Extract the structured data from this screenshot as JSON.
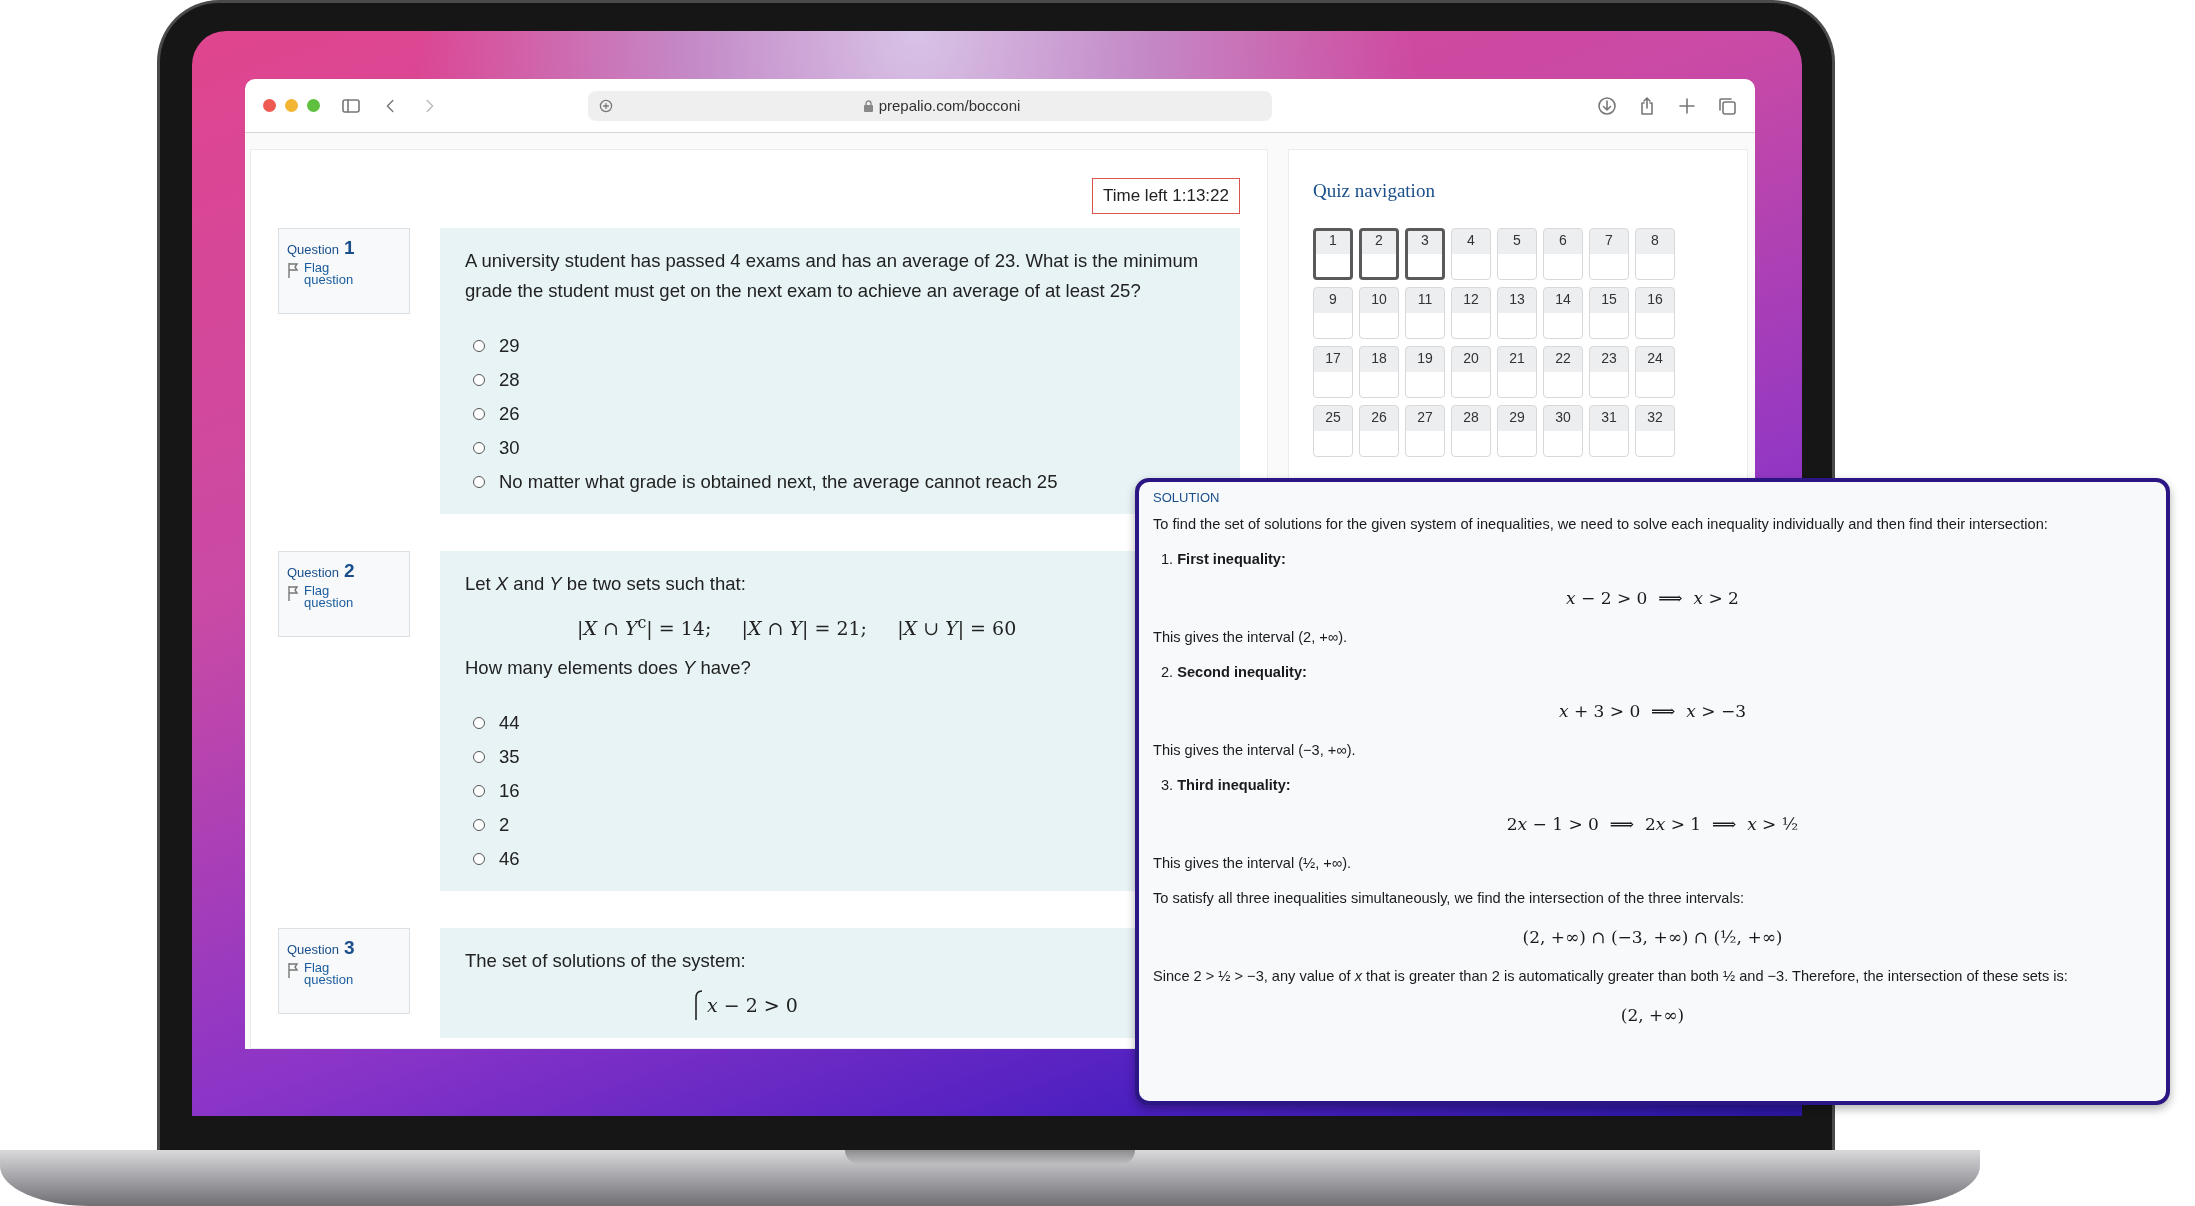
{
  "browser": {
    "url": "prepalio.com/bocconi"
  },
  "timer": "Time left 1:13:22",
  "questions": [
    {
      "label": "Question",
      "number": "1",
      "flag": "Flag question",
      "parts": [
        {
          "kind": "text",
          "text": "A university student has passed 4 exams and has an average of 23. What is the minimum grade the student must get on the next exam to achieve an average of at least 25?"
        }
      ],
      "options": [
        {
          "text": "29",
          "selected": false
        },
        {
          "text": "28",
          "selected": false
        },
        {
          "text": "26",
          "selected": false
        },
        {
          "text": "30",
          "selected": false
        },
        {
          "text": "No matter what grade is obtained next, the average cannot reach 25",
          "selected": false
        }
      ]
    },
    {
      "label": "Question",
      "number": "2",
      "flag": "Flag question",
      "parts": [
        {
          "kind": "text",
          "text": "Let *X* and *Y* be two sets such that:"
        },
        {
          "kind": "formula",
          "text": "|*X* ∩ *Y*$^{c}$| = 14;     |*X* ∩ *Y*| = 21;     |*X* ∪ *Y*| = 60"
        },
        {
          "kind": "text",
          "text": "How many elements does *Y* have?"
        }
      ],
      "options": [
        {
          "text": "44",
          "selected": false
        },
        {
          "text": "35",
          "selected": false
        },
        {
          "text": "16",
          "selected": false
        },
        {
          "text": "2",
          "selected": false
        },
        {
          "text": "46",
          "selected": false
        }
      ]
    },
    {
      "label": "Question",
      "number": "3",
      "flag": "Flag question",
      "parts": [
        {
          "kind": "text",
          "text": "The set of solutions of the system:"
        },
        {
          "kind": "system",
          "text": "𝑥 − 2 > 0"
        }
      ]
    }
  ],
  "quiz_navigation": {
    "title": "Quiz navigation",
    "buttons": [
      {
        "label": "1",
        "selected": true
      },
      {
        "label": "2",
        "selected": true
      },
      {
        "label": "3",
        "selected": true
      },
      {
        "label": "4",
        "selected": false
      },
      {
        "label": "5",
        "selected": false
      },
      {
        "label": "6",
        "selected": false
      },
      {
        "label": "7",
        "selected": false
      },
      {
        "label": "8",
        "selected": false
      },
      {
        "label": "9",
        "selected": false
      },
      {
        "label": "10",
        "selected": false
      },
      {
        "label": "11",
        "selected": false
      },
      {
        "label": "12",
        "selected": false
      },
      {
        "label": "13",
        "selected": false
      },
      {
        "label": "14",
        "selected": false
      },
      {
        "label": "15",
        "selected": false
      },
      {
        "label": "16",
        "selected": false
      },
      {
        "label": "17",
        "selected": false
      },
      {
        "label": "18",
        "selected": false
      },
      {
        "label": "19",
        "selected": false
      },
      {
        "label": "20",
        "selected": false
      },
      {
        "label": "21",
        "selected": false
      },
      {
        "label": "22",
        "selected": false
      },
      {
        "label": "23",
        "selected": false
      },
      {
        "label": "24",
        "selected": false
      },
      {
        "label": "25",
        "selected": false
      },
      {
        "label": "26",
        "selected": false
      },
      {
        "label": "27",
        "selected": false
      },
      {
        "label": "28",
        "selected": false
      },
      {
        "label": "29",
        "selected": false
      },
      {
        "label": "30",
        "selected": false
      },
      {
        "label": "31",
        "selected": false
      },
      {
        "label": "32",
        "selected": false
      }
    ]
  },
  "solution": {
    "title": "SOLUTION",
    "blocks": [
      {
        "kind": "para",
        "text": "To find the set of solutions for the given system of inequalities, we need to solve each inequality individually and then find their intersection:"
      },
      {
        "kind": "step",
        "number": "1.",
        "text": "First inequality:"
      },
      {
        "kind": "formula",
        "text": "𝑥 − 2 > 0  ⟹  𝑥 > 2"
      },
      {
        "kind": "para",
        "text": "This gives the interval (2, +∞)."
      },
      {
        "kind": "step",
        "number": "2.",
        "text": "Second inequality:"
      },
      {
        "kind": "formula",
        "text": "𝑥 + 3 > 0  ⟹  𝑥 > −3"
      },
      {
        "kind": "para",
        "text": "This gives the interval (−3, +∞)."
      },
      {
        "kind": "step",
        "number": "3.",
        "text": "Third inequality:"
      },
      {
        "kind": "formula",
        "text": "2𝑥 − 1 > 0  ⟹  2𝑥 > 1  ⟹  𝑥 > ½"
      },
      {
        "kind": "para",
        "text": "This gives the interval (½, +∞)."
      },
      {
        "kind": "para",
        "text": "To satisfy all three inequalities simultaneously, we find the intersection of the three intervals:"
      },
      {
        "kind": "formula",
        "text": "(2, +∞) ∩ (−3, +∞) ∩ (½, +∞)"
      },
      {
        "kind": "para",
        "text": "Since 2 > ½ > −3, any value of *x* that is greater than 2 is automatically greater than both ½ and −3. Therefore, the intersection of these sets is:"
      },
      {
        "kind": "formula",
        "text": "(2, +∞)"
      }
    ]
  }
}
